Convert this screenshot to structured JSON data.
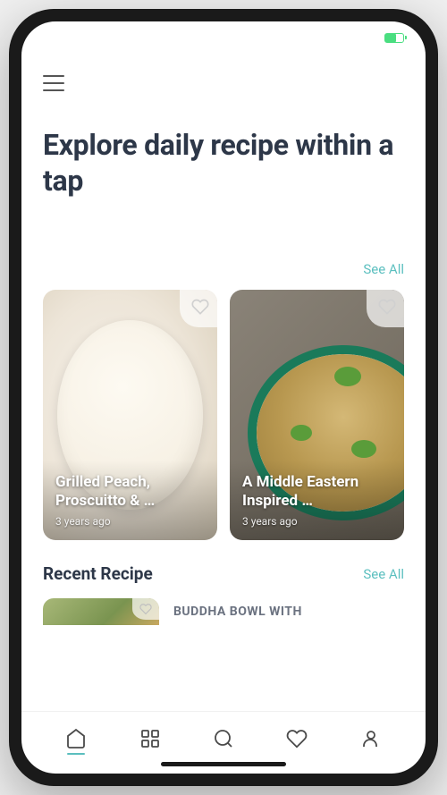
{
  "hero": {
    "title": "Explore daily recipe within a tap"
  },
  "featured": {
    "see_all": "See All",
    "cards": [
      {
        "title": "Grilled Peach, Proscuitto & …",
        "date": "3 years ago"
      },
      {
        "title": "A Middle Eastern Inspired …",
        "date": "3 years ago"
      }
    ]
  },
  "recent": {
    "heading": "Recent Recipe",
    "see_all": "See All",
    "items": [
      {
        "title": "BUDDHA BOWL WITH"
      }
    ]
  },
  "nav": {
    "items": [
      "home",
      "categories",
      "search",
      "favorites",
      "profile"
    ],
    "active": "home"
  },
  "colors": {
    "accent": "#5bbfbf",
    "text_primary": "#2d3748",
    "text_secondary": "#6b7280"
  }
}
